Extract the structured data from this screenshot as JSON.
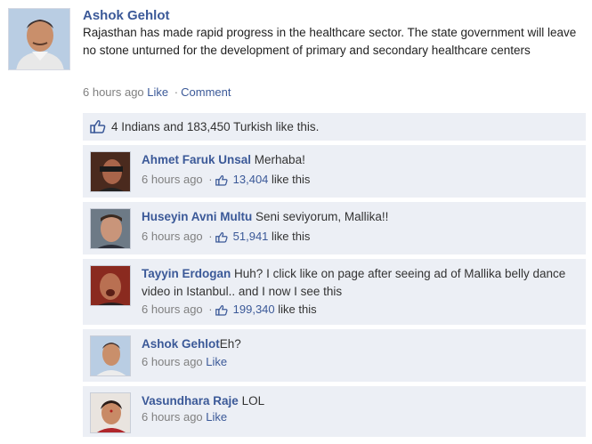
{
  "post": {
    "author": "Ashok Gehlot",
    "text": "Rajasthan has made rapid progress in the healthcare sector. The state government will leave no stone unturned for the development of primary and secondary healthcare centers",
    "time": "6 hours ago",
    "like_label": "Like",
    "comment_label": "Comment"
  },
  "likes_summary": "4 Indians and 183,450 Turkish like this.",
  "comments": [
    {
      "author": "Ahmet Faruk Unsal",
      "text": "Merhaba!",
      "time": "6 hours ago",
      "likes": "13,404",
      "likes_suffix": "like this"
    },
    {
      "author": "Huseyin Avni Multu",
      "text": "Seni seviyorum, Mallika!!",
      "time": "6 hours ago",
      "likes": "51,941",
      "likes_suffix": "like this"
    },
    {
      "author": "Tayyin Erdogan",
      "text": "Huh? I click like on page after seeing ad of Mallika belly dance video in Istanbul.. and I now I see this",
      "time": "6 hours ago",
      "likes": "199,340",
      "likes_suffix": "like this"
    },
    {
      "author": "Ashok Gehlot",
      "text": "Eh?",
      "time": "6 hours ago",
      "like_label": "Like"
    },
    {
      "author": "Vasundhara Raje",
      "text": "LOL",
      "time": "6 hours ago",
      "like_label": "Like"
    }
  ],
  "colors": {
    "link": "#3b5998",
    "comment_bg": "#eceff5",
    "meta": "#808080"
  },
  "icons": {
    "like": "thumbs-up-icon"
  }
}
